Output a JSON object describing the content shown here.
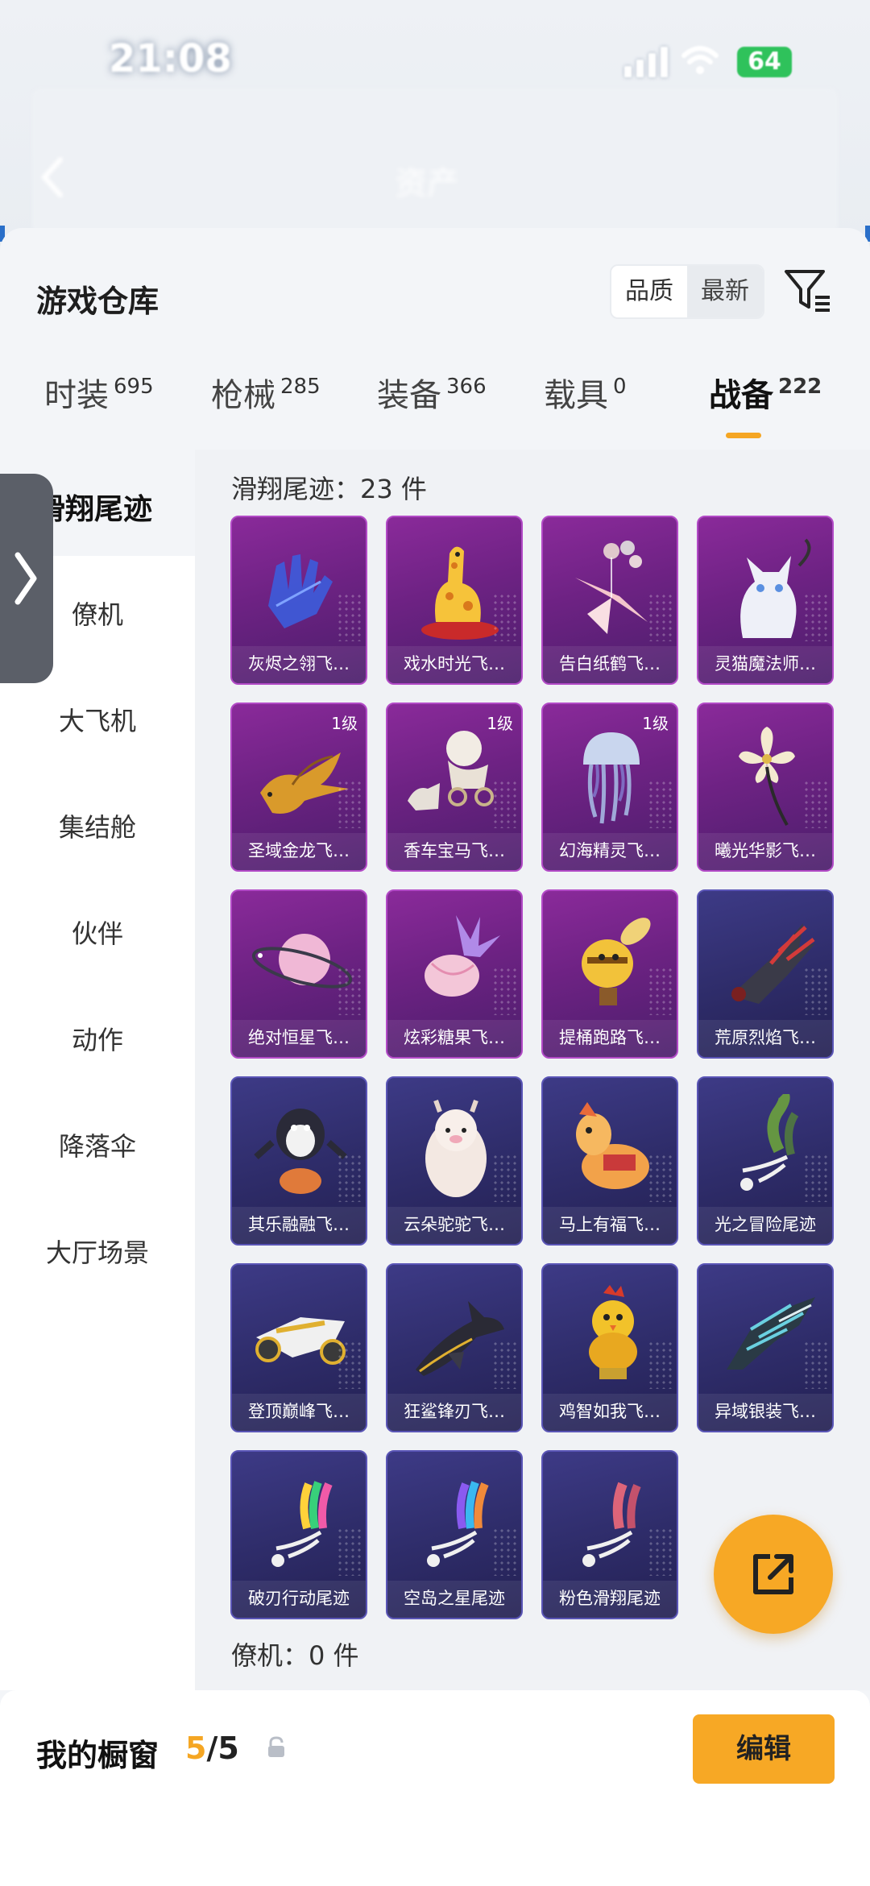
{
  "status_bar": {
    "time": "21:08",
    "battery": "64",
    "ghost_left": "",
    "ghost_right": ""
  },
  "header": {
    "title": "资产"
  },
  "warehouse": {
    "title": "游戏仓库",
    "sort_options": [
      "品质",
      "最新"
    ],
    "active_sort": "品质"
  },
  "tabs": [
    {
      "label": "时装",
      "count": "695"
    },
    {
      "label": "枪械",
      "count": "285"
    },
    {
      "label": "装备",
      "count": "366"
    },
    {
      "label": "载具",
      "count": "0"
    },
    {
      "label": "战备",
      "count": "222"
    }
  ],
  "active_tab": "战备",
  "sidebar": {
    "active": "滑翔尾迹",
    "items": [
      "僚机",
      "大飞机",
      "集结舱",
      "伙伴",
      "动作",
      "降落伞",
      "大厅场景"
    ]
  },
  "section": {
    "label": "滑翔尾迹：23 件",
    "footer_label": "僚机：0 件"
  },
  "items": [
    {
      "name": "灰烬之翎飞…",
      "rarity": "purple",
      "level": "",
      "icon": "blue-glove-icon"
    },
    {
      "name": "戏水时光飞…",
      "rarity": "purple",
      "level": "",
      "icon": "giraffe-float-icon"
    },
    {
      "name": "告白纸鹤飞…",
      "rarity": "purple",
      "level": "",
      "icon": "paper-crane-icon"
    },
    {
      "name": "灵猫魔法师…",
      "rarity": "purple",
      "level": "",
      "icon": "white-cat-icon"
    },
    {
      "name": "圣域金龙飞…",
      "rarity": "purple",
      "level": "1级",
      "icon": "golden-dragon-icon"
    },
    {
      "name": "香车宝马飞…",
      "rarity": "purple",
      "level": "1级",
      "icon": "carriage-icon"
    },
    {
      "name": "幻海精灵飞…",
      "rarity": "purple",
      "level": "1级",
      "icon": "jellyfish-icon"
    },
    {
      "name": "曦光华影飞…",
      "rarity": "purple",
      "level": "",
      "icon": "flower-icon"
    },
    {
      "name": "绝对恒星飞…",
      "rarity": "purple",
      "level": "",
      "icon": "planet-icon"
    },
    {
      "name": "炫彩糖果飞…",
      "rarity": "purple",
      "level": "",
      "icon": "candy-icon"
    },
    {
      "name": "提桶跑路飞…",
      "rarity": "purple",
      "level": "",
      "icon": "bee-icon"
    },
    {
      "name": "荒原烈焰飞…",
      "rarity": "blue",
      "level": "",
      "icon": "flame-craft-icon"
    },
    {
      "name": "其乐融融飞…",
      "rarity": "blue",
      "level": "",
      "icon": "penguin-icon"
    },
    {
      "name": "云朵驼驼飞…",
      "rarity": "blue",
      "level": "",
      "icon": "alpaca-icon"
    },
    {
      "name": "马上有福飞…",
      "rarity": "blue",
      "level": "",
      "icon": "horse-icon"
    },
    {
      "name": "光之冒险尾迹",
      "rarity": "blue",
      "level": "",
      "icon": "green-trail-icon"
    },
    {
      "name": "登顶巅峰飞…",
      "rarity": "blue",
      "level": "",
      "icon": "jet-glider-icon"
    },
    {
      "name": "狂鲨锋刃飞…",
      "rarity": "blue",
      "level": "",
      "icon": "shark-icon"
    },
    {
      "name": "鸡智如我飞…",
      "rarity": "blue",
      "level": "",
      "icon": "chicken-icon"
    },
    {
      "name": "异域银装飞…",
      "rarity": "blue",
      "level": "",
      "icon": "silver-wing-icon"
    },
    {
      "name": "破刃行动尾迹",
      "rarity": "blue",
      "level": "",
      "icon": "rainbow-trail-icon"
    },
    {
      "name": "空岛之星尾迹",
      "rarity": "blue",
      "level": "",
      "icon": "star-trail-icon"
    },
    {
      "name": "粉色滑翔尾迹",
      "rarity": "blue",
      "level": "",
      "icon": "pink-trail-icon"
    }
  ],
  "showcase": {
    "title": "我的橱窗",
    "current": "5",
    "total": "/5",
    "edit_label": "编辑"
  },
  "colors": {
    "accent": "#f7a825",
    "purple_tile": "#6d2283",
    "blue_tile": "#2f2d6b"
  }
}
